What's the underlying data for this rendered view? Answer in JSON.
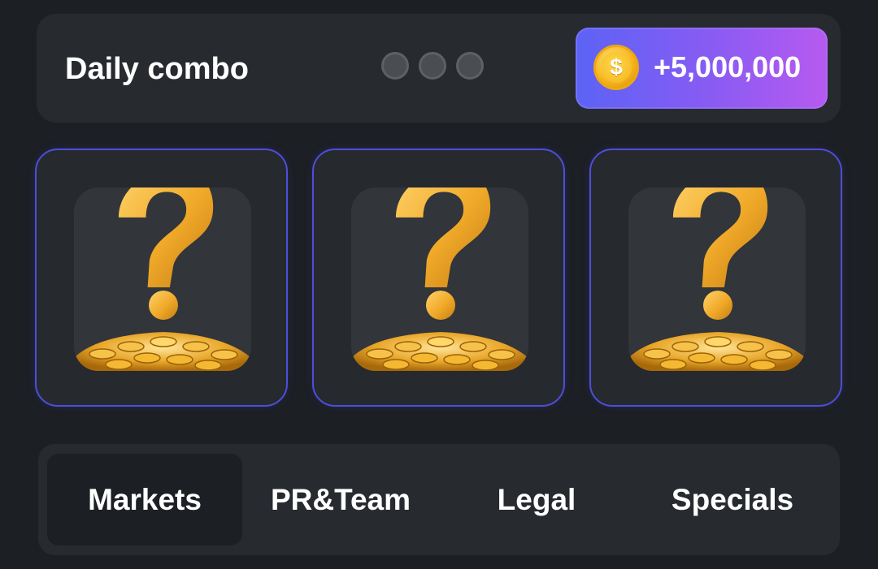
{
  "daily_combo": {
    "title": "Daily combo",
    "slots_filled": 0,
    "slots_total": 3,
    "reward": {
      "icon": "dollar-coin-icon",
      "coin_symbol": "$",
      "amount": "+5,000,000"
    }
  },
  "cards": [
    {
      "icon": "question-mark-coins-icon"
    },
    {
      "icon": "question-mark-coins-icon"
    },
    {
      "icon": "question-mark-coins-icon"
    }
  ],
  "tabs": [
    {
      "label": "Markets",
      "active": true
    },
    {
      "label": "PR&Team",
      "active": false
    },
    {
      "label": "Legal",
      "active": false
    },
    {
      "label": "Specials",
      "active": false
    }
  ],
  "colors": {
    "background": "#1c1f24",
    "panel": "#272a2f",
    "card_border": "#4e4ed9",
    "badge_gradient_start": "#5b63f5",
    "badge_gradient_end": "#b75af0",
    "gold": "#f2b52c"
  }
}
